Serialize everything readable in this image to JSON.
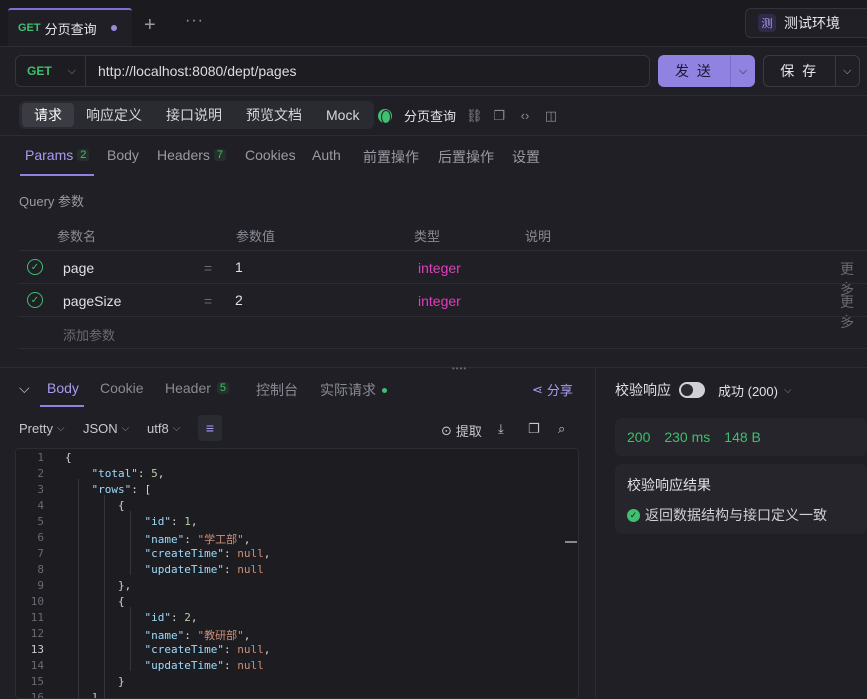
{
  "tab": {
    "method": "GET",
    "name": "分页查询"
  },
  "env": {
    "badge": "测",
    "label": "测试环境"
  },
  "request": {
    "method": "GET",
    "url": "http://localhost:8080/dept/pages",
    "send_label": "发 送",
    "save_label": "保 存"
  },
  "subtabs": [
    "请求",
    "响应定义",
    "接口说明",
    "预览文档",
    "Mock"
  ],
  "doc_name": "分页查询",
  "param_tabs": [
    {
      "label": "Params",
      "count": "2"
    },
    {
      "label": "Body",
      "count": ""
    },
    {
      "label": "Headers",
      "count": "7"
    },
    {
      "label": "Cookies",
      "count": ""
    },
    {
      "label": "Auth",
      "count": ""
    },
    {
      "label": "前置操作",
      "count": ""
    },
    {
      "label": "后置操作",
      "count": ""
    },
    {
      "label": "设置",
      "count": ""
    }
  ],
  "query_label": "Query 参数",
  "columns": [
    "参数名",
    "参数值",
    "类型",
    "说明"
  ],
  "params": [
    {
      "name": "page",
      "eq": "=",
      "value": "1",
      "type": "integer",
      "more": "更多"
    },
    {
      "name": "pageSize",
      "eq": "=",
      "value": "2",
      "type": "integer",
      "more": "更多"
    }
  ],
  "add_param": "添加参数",
  "response_tabs": [
    {
      "label": "Body",
      "count": ""
    },
    {
      "label": "Cookie",
      "count": ""
    },
    {
      "label": "Header",
      "count": "5"
    },
    {
      "label": "控制台",
      "count": ""
    },
    {
      "label": "实际请求",
      "count": ""
    }
  ],
  "share_label": "分享",
  "toolbar": {
    "pretty": "Pretty",
    "format": "JSON",
    "encoding": "utf8",
    "extract": "提取"
  },
  "code_lines": [
    "{",
    "    \"total\": 5,",
    "    \"rows\": [",
    "        {",
    "            \"id\": 1,",
    "            \"name\": \"学工部\",",
    "            \"createTime\": null,",
    "            \"updateTime\": null",
    "        },",
    "        {",
    "            \"id\": 2,",
    "            \"name\": \"教研部\",",
    "            \"createTime\": null,",
    "            \"updateTime\": null",
    "        }",
    "    ]"
  ],
  "verify": {
    "label": "校验响应",
    "status": "成功 (200)"
  },
  "metrics": {
    "code": "200",
    "time": "230 ms",
    "size": "148 B"
  },
  "result": {
    "title": "校验响应结果",
    "message": "返回数据结构与接口定义一致"
  },
  "colors": {
    "accent": "#8f82e0",
    "success": "#3fbf6f",
    "type": "#e23dbd"
  }
}
